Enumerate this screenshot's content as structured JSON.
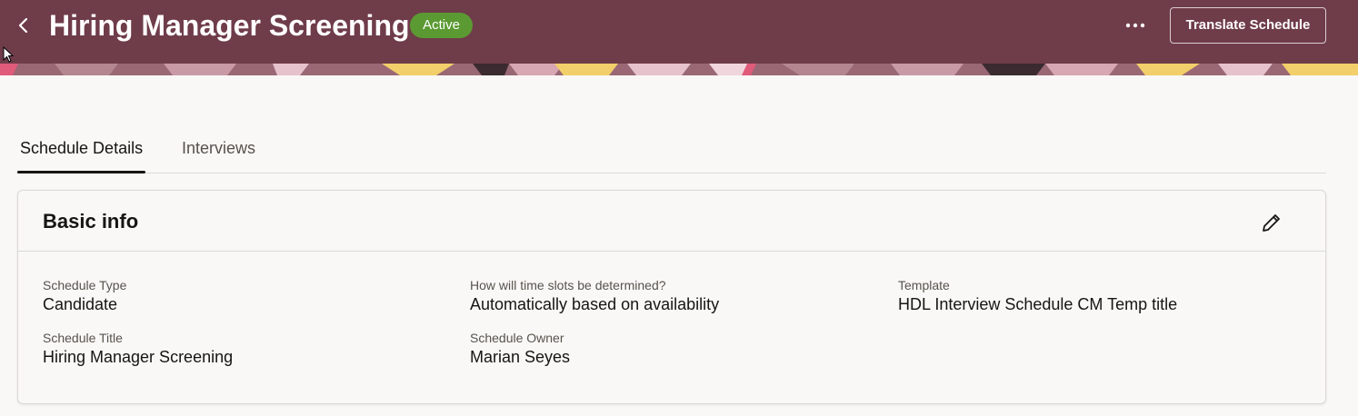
{
  "header": {
    "title": "Hiring Manager Screening",
    "status": "Active",
    "more_label": "•••",
    "translate_button": "Translate Schedule"
  },
  "tabs": [
    {
      "label": "Schedule Details",
      "selected": true
    },
    {
      "label": "Interviews",
      "selected": false
    }
  ],
  "card": {
    "title": "Basic info",
    "fields": {
      "schedule_type": {
        "label": "Schedule Type",
        "value": "Candidate"
      },
      "time_slots": {
        "label": "How will time slots be determined?",
        "value": "Automatically based on availability"
      },
      "template": {
        "label": "Template",
        "value": "HDL Interview Schedule CM Temp title"
      },
      "schedule_title": {
        "label": "Schedule Title",
        "value": "Hiring Manager Screening"
      },
      "schedule_owner": {
        "label": "Schedule Owner",
        "value": "Marian Seyes"
      }
    }
  },
  "colors": {
    "header_bg": "#6f3c4a",
    "status_green": "#5b9a32"
  },
  "icons": [
    "chevron-left-icon",
    "more-icon",
    "pencil-icon"
  ]
}
